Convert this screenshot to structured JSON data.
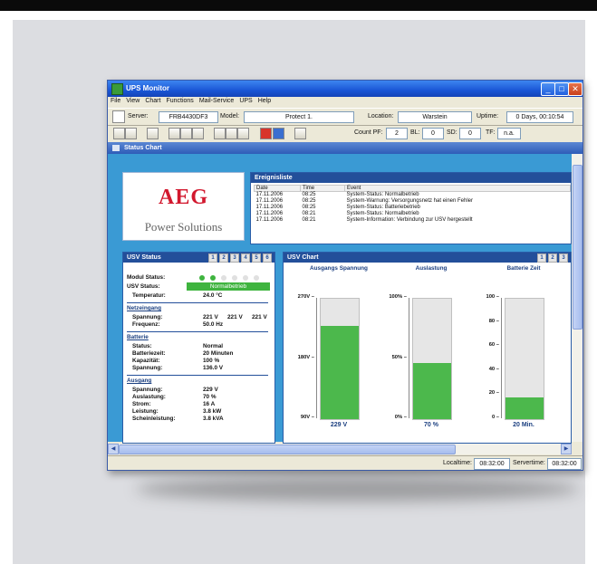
{
  "window": {
    "title": "UPS Monitor"
  },
  "menu": [
    "File",
    "View",
    "Chart",
    "Functions",
    "Mail-Service",
    "UPS",
    "Help"
  ],
  "info": {
    "server_label": "Server:",
    "server_value": "FRB4430DF3",
    "model_label": "Model:",
    "model_value": "Protect 1.",
    "location_label": "Location:",
    "location_value": "Warstein",
    "uptime_label": "Uptime:",
    "uptime_value": "0 Days, 00:10:54"
  },
  "counters": {
    "count_pf_label": "Count PF:",
    "count_pf_value": "2",
    "bl_label": "BL:",
    "bl_value": "0",
    "sd_label": "SD:",
    "sd_value": "0",
    "tf_label": "TF:",
    "tf_value": "n.a."
  },
  "panel_title": "Status Chart",
  "logo": {
    "brand": "AEG",
    "tagline": "Power Solutions",
    "brand_color": "#d2182e"
  },
  "events": {
    "title": "Ereignisliste",
    "columns": [
      "Date",
      "Time",
      "Event"
    ],
    "rows": [
      [
        "17.11.2006",
        "08:25",
        "System-Status: Normalbetrieb"
      ],
      [
        "17.11.2006",
        "08:25",
        "System-Warnung: Versorgungsnetz hat einen Fehler"
      ],
      [
        "17.11.2006",
        "08:25",
        "System-Status: Batteriebetrieb"
      ],
      [
        "17.11.2006",
        "08:21",
        "System-Status: Normalbetrieb"
      ],
      [
        "17.11.2006",
        "08:21",
        "System-Information: Verbindung zur USV hergestellt"
      ]
    ]
  },
  "usv_status": {
    "title": "USV Status",
    "tabs": [
      "1",
      "2",
      "3",
      "4",
      "5",
      "6"
    ],
    "modul_label": "Modul Status:",
    "modul_dots": [
      "#3fb43f",
      "#3fb43f",
      "#e0e0e0",
      "#e0e0e0",
      "#e0e0e0",
      "#e0e0e0"
    ],
    "usv_label": "USV Status:",
    "usv_value": "Normalbetrieb",
    "temp_label": "Temperatur:",
    "temp_value": "24.0 °C",
    "netz_title": "Netzeingang",
    "spannung_label": "Spannung:",
    "spannung_values": [
      "221 V",
      "221 V",
      "221 V"
    ],
    "frequenz_label": "Frequenz:",
    "frequenz_value": "50.0 Hz",
    "batterie_title": "Batterie",
    "b_status_label": "Status:",
    "b_status_value": "Normal",
    "b_zeit_label": "Batteriezeit:",
    "b_zeit_value": "20 Minuten",
    "b_kap_label": "Kapazität:",
    "b_kap_value": "100 %",
    "b_span_label": "Spannung:",
    "b_span_value": "136.0 V",
    "ausgang_title": "Ausgang",
    "a_span_label": "Spannung:",
    "a_span_value": "229 V",
    "a_ausl_label": "Auslastung:",
    "a_ausl_value": "70 %",
    "a_strom_label": "Strom:",
    "a_strom_value": "16 A",
    "a_leist_label": "Leistung:",
    "a_leist_value": "3.8 kW",
    "a_schein_label": "Scheinleistung:",
    "a_schein_value": "3.8 kVA"
  },
  "usv_chart": {
    "title": "USV Chart",
    "tabs": [
      "1",
      "2",
      "3"
    ]
  },
  "chart_data": {
    "type": "bar",
    "gauges": [
      {
        "title": "Ausgangs Spannung",
        "ticks": [
          "270V",
          "180V",
          "90V"
        ],
        "range": [
          90,
          270
        ],
        "value": 229,
        "label": "229 V"
      },
      {
        "title": "Auslastung",
        "ticks": [
          "100%",
          "50%",
          "0%"
        ],
        "range": [
          0,
          150
        ],
        "value": 70,
        "label": "70 %"
      },
      {
        "title": "Batterie Zeit",
        "ticks": [
          "100",
          "80",
          "60",
          "40",
          "20",
          "0"
        ],
        "range": [
          0,
          110
        ],
        "value": 20,
        "label": "20 Min."
      }
    ]
  },
  "status": {
    "localtime_label": "Localtime:",
    "localtime_value": "08:32:00",
    "servertime_label": "Servertime:",
    "servertime_value": "08:32:00"
  }
}
